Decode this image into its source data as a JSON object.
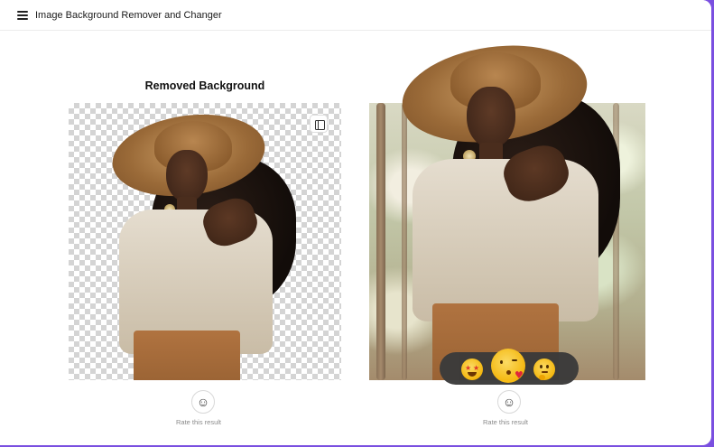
{
  "header": {
    "menu_icon": "hamburger-menu-icon",
    "title": "Image Background Remover and Changer"
  },
  "left_panel": {
    "title": "Removed Background",
    "compare_icon": "split-view-icon",
    "rate_icon": "smiley-icon",
    "rate_label": "Rate this result"
  },
  "right_panel": {
    "rate_icon": "smiley-icon",
    "rate_label": "Rate this result",
    "reactions": [
      "star-struck-emoji-icon",
      "kissing-heart-emoji-icon",
      "thinking-emoji-icon"
    ]
  },
  "colors": {
    "accent_frame": "#7a4fe0",
    "checker": "#d4d4d4",
    "reaction_bar": "#3a3a3a"
  }
}
